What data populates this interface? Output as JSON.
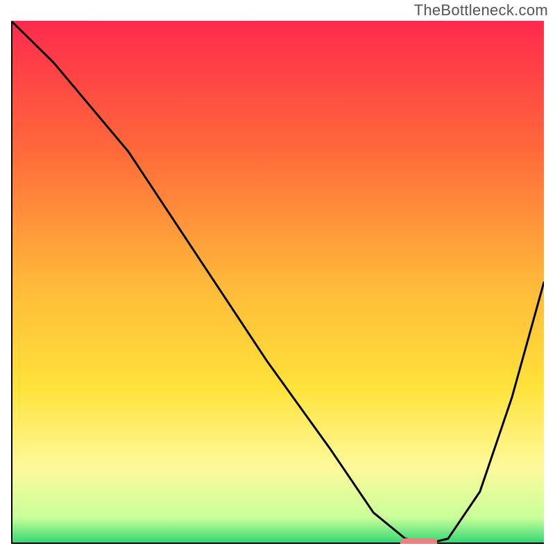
{
  "watermark": "TheBottleneck.com",
  "chart_data": {
    "type": "line",
    "title": "",
    "xlabel": "",
    "ylabel": "",
    "xlim": [
      0,
      100
    ],
    "ylim": [
      0,
      100
    ],
    "grid": false,
    "legend": false,
    "background": {
      "type": "vertical-gradient",
      "stops": [
        {
          "pct": 0,
          "color": "#ff2a4d"
        },
        {
          "pct": 25,
          "color": "#ff6a3a"
        },
        {
          "pct": 50,
          "color": "#ffb83a"
        },
        {
          "pct": 70,
          "color": "#ffe23a"
        },
        {
          "pct": 85,
          "color": "#fff99a"
        },
        {
          "pct": 95,
          "color": "#c8ff9a"
        },
        {
          "pct": 100,
          "color": "#2ed573"
        }
      ]
    },
    "series": [
      {
        "name": "bottleneck-curve",
        "x": [
          0,
          8,
          22,
          35,
          48,
          60,
          68,
          74,
          78,
          82,
          88,
          94,
          100
        ],
        "y": [
          100,
          92,
          75,
          55,
          35,
          18,
          6,
          1,
          0,
          1,
          10,
          28,
          50
        ]
      }
    ],
    "marker": {
      "name": "optimal-range",
      "x_start": 73,
      "x_end": 80,
      "y": 0,
      "color": "#e98382"
    }
  }
}
